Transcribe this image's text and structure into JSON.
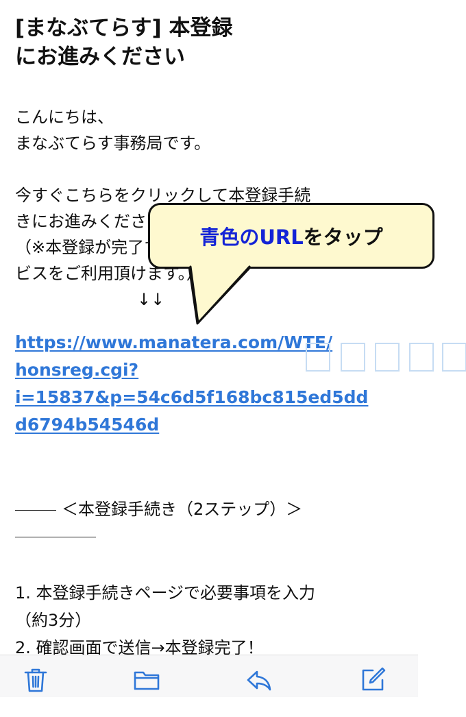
{
  "email": {
    "subject_line1": "[まなぶてらす] 本登録",
    "subject_line2": "にお進みください",
    "greeting_line1": "こんにちは、",
    "greeting_line2": "まなぶてらす事務局です。",
    "para_line1": "今すぐこちらをクリックして本登録手続",
    "para_line2": "きにお進みください。",
    "para_line3": "（※本登録が完了すると、全てのサー",
    "para_line4": "ビスをご利用頂けます。）",
    "arrows": "↓↓",
    "link_line1": "https://www.manatera.com/WTE/",
    "link_line2": "honsreg.cgi?",
    "link_line3": "i=15837&p=54c6d5f168bc815ed5dd",
    "link_line4": "d6794b54546d",
    "steps_heading": "＜本登録手続き（2ステップ）＞",
    "step1": "1.  本登録手続きページで必要事項を入力",
    "step1_note": "（約3分）",
    "step2": "2.  確認画面で送信→本登録完了！"
  },
  "callout": {
    "text_blue": "青色のURL",
    "text_rest": "をタップ"
  },
  "toolbar": {
    "icons": [
      "trash-icon",
      "folder-icon",
      "reply-icon",
      "compose-icon"
    ],
    "accent": "#2f77d8"
  },
  "colors": {
    "link": "#2f77d8",
    "callout_fill": "#fef9cf",
    "callout_highlight": "#1424d6"
  }
}
